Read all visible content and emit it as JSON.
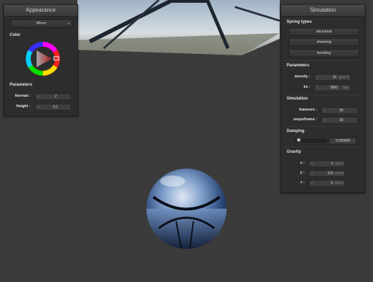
{
  "appearance": {
    "title": "Appearance",
    "material": "Mirror",
    "color_label": "Color",
    "parameters_label": "Parameters",
    "normal_label": "Normal :",
    "normal_value": "2",
    "height_label": "Height :",
    "height_value": "0.1"
  },
  "simulation": {
    "title": "Simulation",
    "spring_types_label": "Spring types",
    "spring_types": [
      "structural",
      "shearing",
      "bending"
    ],
    "parameters_label": "Parameters",
    "density_label": "density :",
    "density_value": "15",
    "density_unit": "g/cm^2",
    "ks_label": "ks :",
    "ks_value": "3000",
    "ks_unit": "N/m",
    "simulation_label": "Simulation",
    "frames_label": "frames/s :",
    "frames_value": "50",
    "steps_label": "steps/frame :",
    "steps_value": "30",
    "damping_label": "Damping",
    "damping_value": "0.200000",
    "damping_unit": "\\",
    "damping_level": 0.05,
    "gravity_label": "Gravity",
    "gx_label": "x :",
    "gx_value": "0",
    "gy_label": "y :",
    "gy_value": "-9.8",
    "gz_label": "z :",
    "gz_value": "0",
    "g_unit": "m/s^2"
  }
}
